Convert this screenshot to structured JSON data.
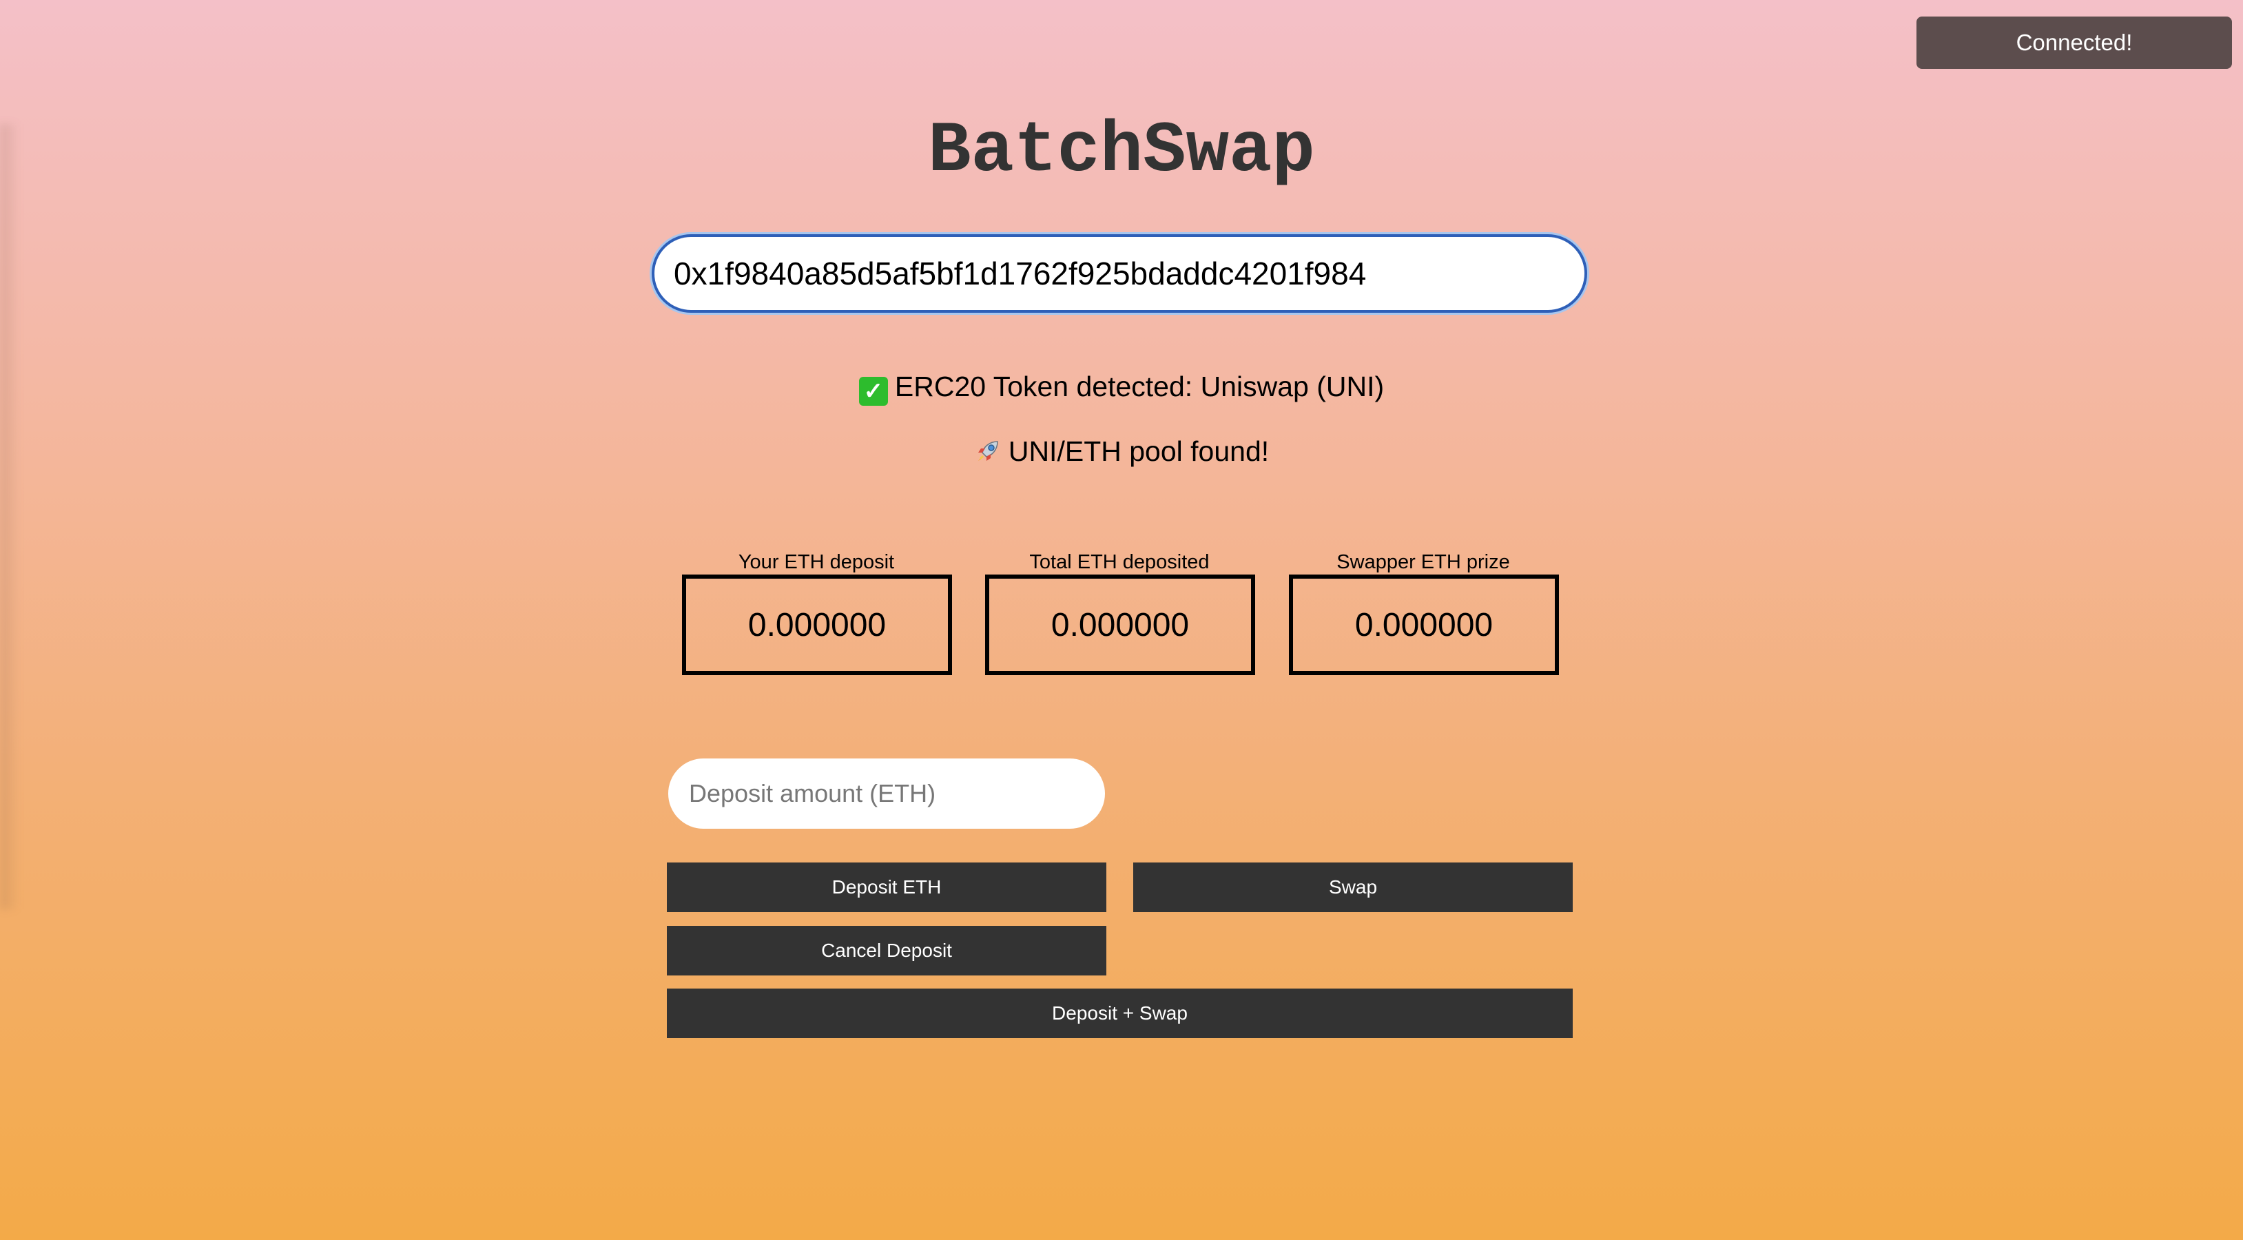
{
  "toast": {
    "text": "Connected!"
  },
  "title": "BatchSwap",
  "token_input": {
    "value": "0x1f9840a85d5af5bf1d1762f925bdaddc4201f984"
  },
  "status": {
    "token_detected": "ERC20 Token detected: Uniswap (UNI)",
    "pool_found": "UNI/ETH pool found!"
  },
  "stats": [
    {
      "label": "Your ETH deposit",
      "value": "0.000000"
    },
    {
      "label": "Total ETH deposited",
      "value": "0.000000"
    },
    {
      "label": "Swapper ETH prize",
      "value": "0.000000"
    }
  ],
  "deposit_input": {
    "placeholder": "Deposit amount (ETH)",
    "value": ""
  },
  "buttons": {
    "deposit": "Deposit ETH",
    "swap": "Swap",
    "cancel": "Cancel Deposit",
    "deposit_swap": "Deposit + Swap"
  },
  "icons": {
    "check": "check-mark-button-icon",
    "rocket": "rocket-icon"
  },
  "colors": {
    "button_bg": "#333333",
    "toast_bg": "#5c4d4d",
    "input_focus": "#2e5fb8"
  }
}
